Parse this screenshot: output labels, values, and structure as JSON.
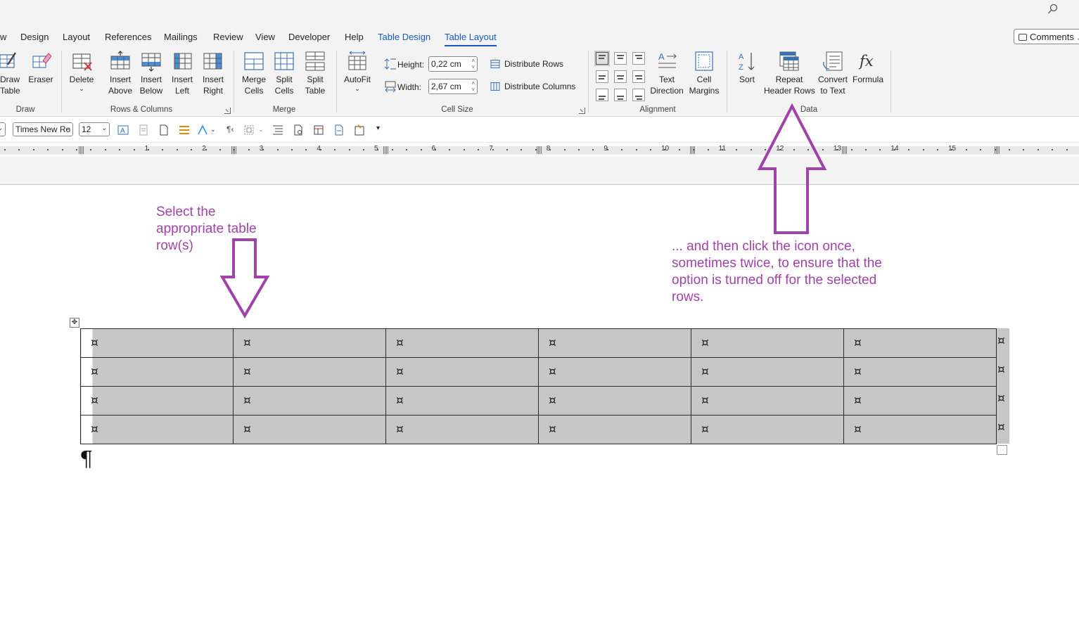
{
  "tabs": [
    {
      "label": "w"
    },
    {
      "label": "Design"
    },
    {
      "label": "Layout"
    },
    {
      "label": "References"
    },
    {
      "label": "Mailings"
    },
    {
      "label": "Review"
    },
    {
      "label": "View"
    },
    {
      "label": "Developer"
    },
    {
      "label": "Help"
    },
    {
      "label": "Table Design"
    },
    {
      "label": "Table Layout"
    }
  ],
  "comments_label": "Comments",
  "ribbon": {
    "draw": {
      "draw_table": [
        "Draw",
        "Table"
      ],
      "eraser": "Eraser",
      "group": "Draw"
    },
    "rows_columns": {
      "delete": "Delete",
      "insert_above": [
        "Insert",
        "Above"
      ],
      "insert_below": [
        "Insert",
        "Below"
      ],
      "insert_left": [
        "Insert",
        "Left"
      ],
      "insert_right": [
        "Insert",
        "Right"
      ],
      "group": "Rows & Columns"
    },
    "merge": {
      "merge_cells": [
        "Merge",
        "Cells"
      ],
      "split_cells": [
        "Split",
        "Cells"
      ],
      "split_table": [
        "Split",
        "Table"
      ],
      "group": "Merge"
    },
    "cell_size": {
      "autofit": "AutoFit",
      "height_label": "Height:",
      "height_value": "0,22 cm",
      "width_label": "Width:",
      "width_value": "2,67 cm",
      "distribute_rows": "Distribute Rows",
      "distribute_columns": "Distribute Columns",
      "group": "Cell Size"
    },
    "alignment": {
      "text_direction": [
        "Text",
        "Direction"
      ],
      "cell_margins": [
        "Cell",
        "Margins"
      ],
      "group": "Alignment"
    },
    "data": {
      "sort": "Sort",
      "repeat_header_rows": [
        "Repeat",
        "Header Rows"
      ],
      "convert_to_text": [
        "Convert",
        "to Text"
      ],
      "formula": "Formula",
      "group": "Data"
    }
  },
  "qat": {
    "font": "Times New Ro",
    "size": "12"
  },
  "ruler_numbers": [
    "1",
    "2",
    "3",
    "4",
    "5",
    "6",
    "7",
    "8",
    "9",
    "10",
    "11",
    "12",
    "13",
    "14",
    "15"
  ],
  "annotations": {
    "left": [
      "Select the",
      "appropriate table",
      "row(s)"
    ],
    "right": [
      "... and then click the icon once,",
      "sometimes twice, to ensure that the",
      "option is turned off for the selected",
      "rows."
    ]
  },
  "colors": {
    "annotation": "#a043a8",
    "accent": "#185abd",
    "selection": "#c6c6c6"
  },
  "table": {
    "rows": [
      [
        "¤",
        "¤",
        "¤",
        "¤",
        "¤",
        "¤"
      ],
      [
        "¤",
        "¤",
        "¤",
        "¤",
        "¤",
        "¤"
      ],
      [
        "¤",
        "¤",
        "¤",
        "¤",
        "¤",
        "¤"
      ],
      [
        "¤",
        "¤",
        "¤",
        "¤",
        "¤",
        "¤"
      ]
    ],
    "row_end_marks": [
      "¤",
      "¤",
      "¤",
      "¤"
    ]
  },
  "pilcrow": "¶"
}
